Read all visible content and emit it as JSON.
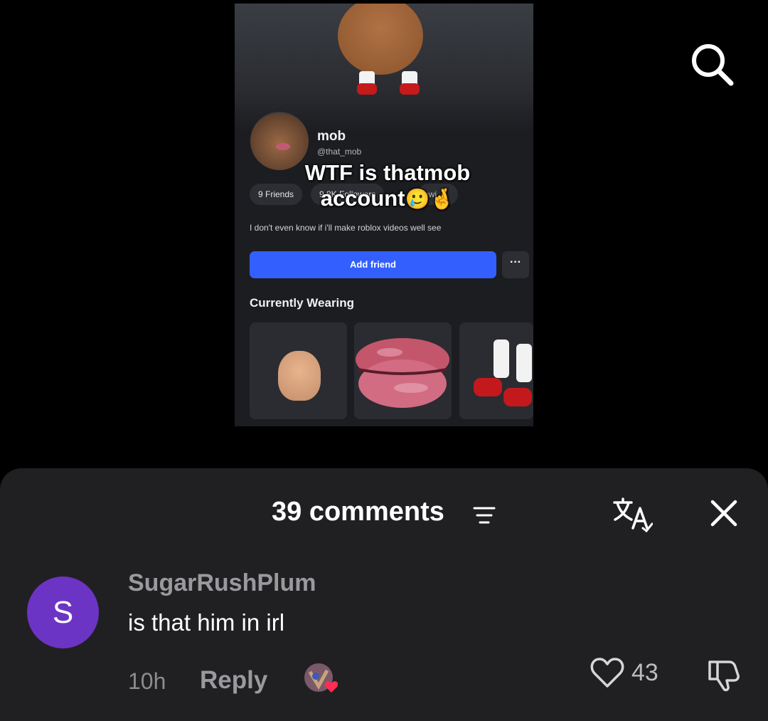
{
  "video": {
    "profile": {
      "display_name": "mob",
      "handle": "@that_mob",
      "friends": "9 Friends",
      "followers": "9.8K Followers",
      "following_fragment": "owi",
      "bio": "I don't even know if i'll make roblox videos well see",
      "add_friend_label": "Add friend",
      "more_label": "···",
      "wearing_title": "Currently Wearing"
    },
    "caption_line1": "WTF is thatmob",
    "caption_line2": "account",
    "caption_emojis": "🥲🤞"
  },
  "top_bar": {
    "search_icon": "search-icon"
  },
  "comments": {
    "title": "39 comments",
    "icons": {
      "sort": "sort-icon",
      "translate": "translate-icon",
      "close": "close-icon"
    },
    "items": [
      {
        "avatar_letter": "S",
        "avatar_color": "#6c34c4",
        "username": "SugarRushPlum",
        "text": "is that him in irl",
        "time": "10h",
        "reply_label": "Reply",
        "likes": "43"
      }
    ]
  }
}
